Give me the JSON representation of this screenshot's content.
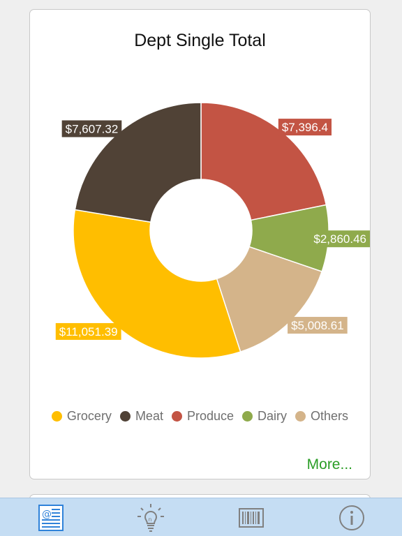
{
  "card": {
    "title": "Dept Single Total",
    "more_label": "More..."
  },
  "chart_data": {
    "type": "pie",
    "title": "Dept Single Total",
    "donut": true,
    "legend_position": "bottom",
    "categories": [
      "Grocery",
      "Meat",
      "Produce",
      "Dairy",
      "Others"
    ],
    "values": [
      11051.39,
      7607.32,
      7396.4,
      2860.46,
      5008.61
    ],
    "labels": [
      "$11,051.39",
      "$7,607.32",
      "$7,396.4",
      "$2,860.46",
      "$5,008.61"
    ],
    "colors": [
      "#ffbe00",
      "#504236",
      "#c35444",
      "#8faa4c",
      "#d4b48a"
    ]
  },
  "tabbar": {
    "items": [
      {
        "name": "tab-report",
        "icon": "report-icon",
        "selected": true
      },
      {
        "name": "tab-tips",
        "icon": "lightbulb-icon",
        "selected": false
      },
      {
        "name": "tab-barcode",
        "icon": "barcode-icon",
        "selected": false
      },
      {
        "name": "tab-info",
        "icon": "info-icon",
        "selected": false
      }
    ]
  }
}
